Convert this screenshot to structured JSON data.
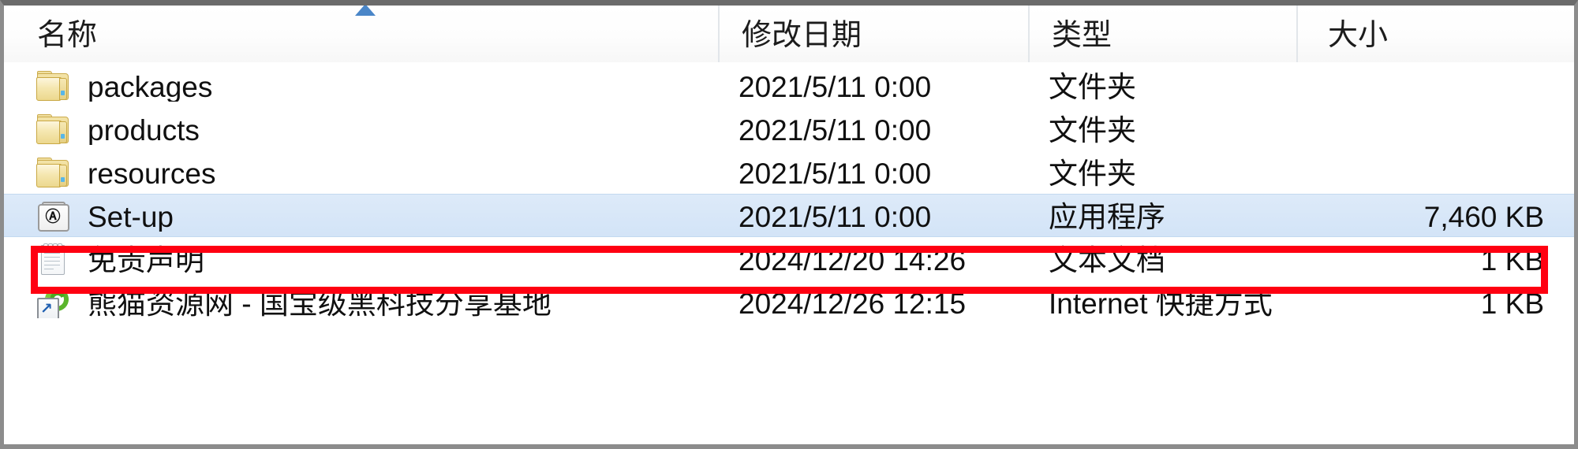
{
  "window": {
    "type": "windows-file-explorer-details-list"
  },
  "columns": {
    "name": "名称",
    "date_modified": "修改日期",
    "type": "类型",
    "size": "大小",
    "sort_column": "名称",
    "sort_direction": "ascending"
  },
  "rows": [
    {
      "icon": "folder-icon",
      "name": "packages",
      "date": "2021/5/11 0:00",
      "type": "文件夹",
      "size": "",
      "selected": false
    },
    {
      "icon": "folder-icon",
      "name": "products",
      "date": "2021/5/11 0:00",
      "type": "文件夹",
      "size": "",
      "selected": false
    },
    {
      "icon": "folder-icon",
      "name": "resources",
      "date": "2021/5/11 0:00",
      "type": "文件夹",
      "size": "",
      "selected": false
    },
    {
      "icon": "application-icon",
      "name": "Set-up",
      "date": "2021/5/11 0:00",
      "type": "应用程序",
      "size": "7,460 KB",
      "selected": true
    },
    {
      "icon": "text-document-icon",
      "name": "免责声明",
      "date": "2024/12/20 14:26",
      "type": "文本文档",
      "size": "1 KB",
      "selected": false
    },
    {
      "icon": "internet-shortcut-icon",
      "name": "熊猫资源网 - 国宝级黑科技分享基地",
      "date": "2024/12/26 12:15",
      "type": "Internet 快捷方式",
      "size": "1 KB",
      "selected": false
    }
  ],
  "annotation": {
    "kind": "highlight-rectangle",
    "target_row_name": "Set-up",
    "color": "#ff0011"
  },
  "icons": {
    "application_glyph": "Ⓐ",
    "shortcut_arrow": "↗"
  },
  "colors": {
    "selection_fill": "#d6e6f8",
    "selection_border": "#c3d9f0",
    "annotation_red": "#ff0011",
    "sort_arrow_blue": "#4a86c8",
    "header_divider": "#e2e6ea",
    "window_border": "#8c8c8c"
  }
}
